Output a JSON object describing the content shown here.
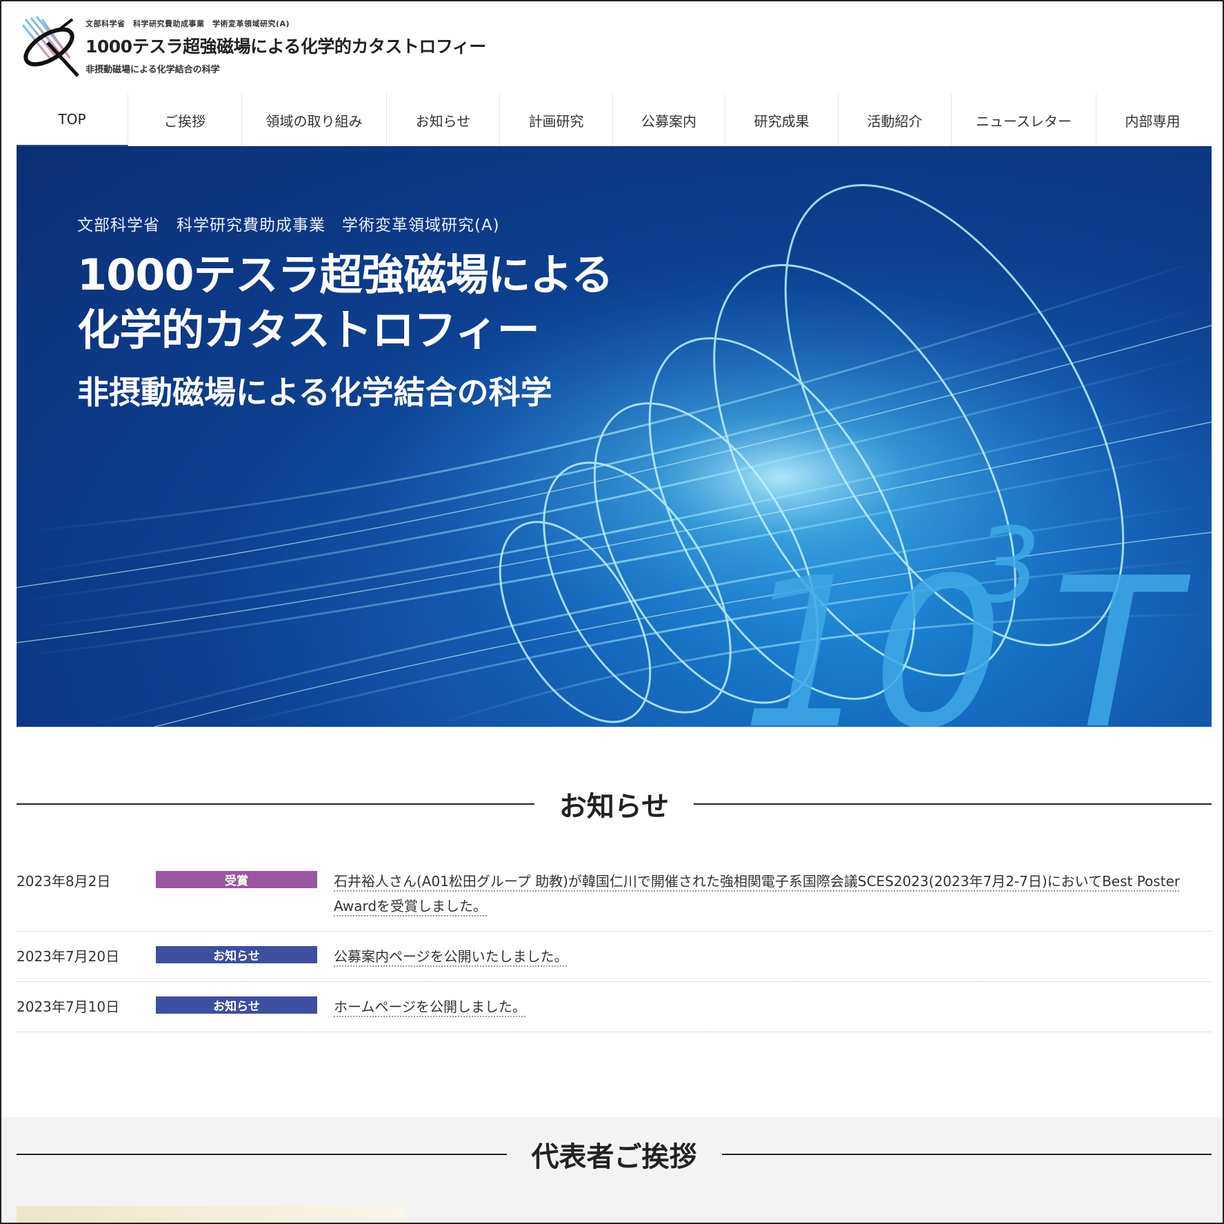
{
  "header": {
    "sub": "文部科学省　科学研究費助成事業　学術変革領域研究(A)",
    "title": "1000テスラ超強磁場による化学的カタストロフィー",
    "tagline": "非摂動磁場による化学結合の科学",
    "logo_icon": "atom-logo-icon"
  },
  "nav": {
    "items": [
      {
        "label": "TOP",
        "active": true
      },
      {
        "label": "ご挨拶"
      },
      {
        "label": "領域の取り組み"
      },
      {
        "label": "お知らせ"
      },
      {
        "label": "計画研究"
      },
      {
        "label": "公募案内"
      },
      {
        "label": "研究成果"
      },
      {
        "label": "活動紹介"
      },
      {
        "label": "ニュースレター"
      },
      {
        "label": "内部専用"
      }
    ]
  },
  "hero": {
    "sub": "文部科学省　科学研究費助成事業　学術変革領域研究(A)",
    "title_line1": "1000テスラ超強磁場による",
    "title_line2": "化学的カタストロフィー",
    "tagline": "非摂動磁場による化学結合の科学",
    "graphic_base": "10",
    "graphic_exp": "3",
    "graphic_unit": "T"
  },
  "news": {
    "title": "お知らせ",
    "items": [
      {
        "date": "2023年8月2日",
        "category": "受賞",
        "color": "#9a56a0",
        "text": "石井裕人さん(A01松田グループ 助教)が韓国仁川で開催された強相関電子系国際会議SCES2023(2023年7月2-7日)においてBest Poster Awardを受賞しました。"
      },
      {
        "date": "2023年7月20日",
        "category": "お知らせ",
        "color": "#3d4f9e",
        "text": "公募案内ページを公開いたしました。"
      },
      {
        "date": "2023年7月10日",
        "category": "お知らせ",
        "color": "#3d4f9e",
        "text": "ホームページを公開しました。"
      }
    ]
  },
  "greeting": {
    "title": "代表者ご挨拶"
  }
}
